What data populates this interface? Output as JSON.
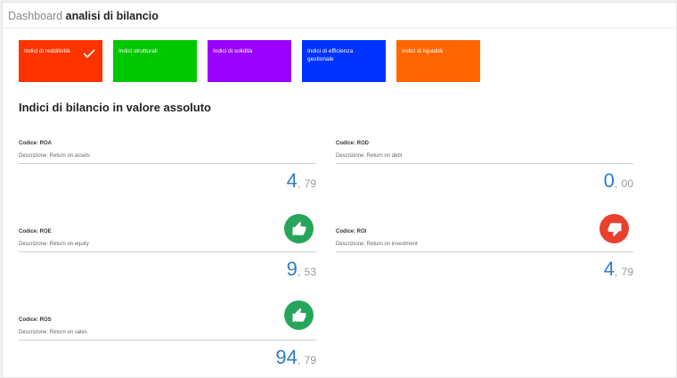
{
  "header": {
    "prefix": "Dashboard",
    "title": "analisi di bilancio"
  },
  "tiles": [
    {
      "label": "Indici di redditività",
      "color": "#ff3300",
      "selected": true
    },
    {
      "label": "Indici strutturali",
      "color": "#00c800"
    },
    {
      "label": "Indici di solidità",
      "color": "#9900ff"
    },
    {
      "label": "Indici di efficienza gestionale",
      "color": "#0033ff"
    },
    {
      "label": "Indici di liquidità",
      "color": "#ff6600"
    }
  ],
  "section_title": "Indici di bilancio in valore assoluto",
  "cards": {
    "roa": {
      "code": "Codice: ROA",
      "desc": "Descrizione: Return on assets",
      "int": "4",
      "sep": ",",
      "dec": "79"
    },
    "rod": {
      "code": "Codice: ROD",
      "desc": "Descrizione: Return on debt",
      "int": "0",
      "sep": ",",
      "dec": "00"
    },
    "roe": {
      "code": "Codice: ROE",
      "desc": "Descrizione: Return on equity",
      "int": "9",
      "sep": ",",
      "dec": "53"
    },
    "roi": {
      "code": "Codice: ROI",
      "desc": "Descrizione: Return on investment",
      "int": "4",
      "sep": ",",
      "dec": "79"
    },
    "ros": {
      "code": "Codice: ROS",
      "desc": "Descrizione: Return on sales",
      "int": "94",
      "sep": ",",
      "dec": "79"
    }
  },
  "icons": {
    "roe": "thumbs-up-icon",
    "roi": "thumbs-down-icon",
    "ros": "thumbs-up-icon",
    "up_color": "#27a55a",
    "down_color": "#e8412e"
  }
}
